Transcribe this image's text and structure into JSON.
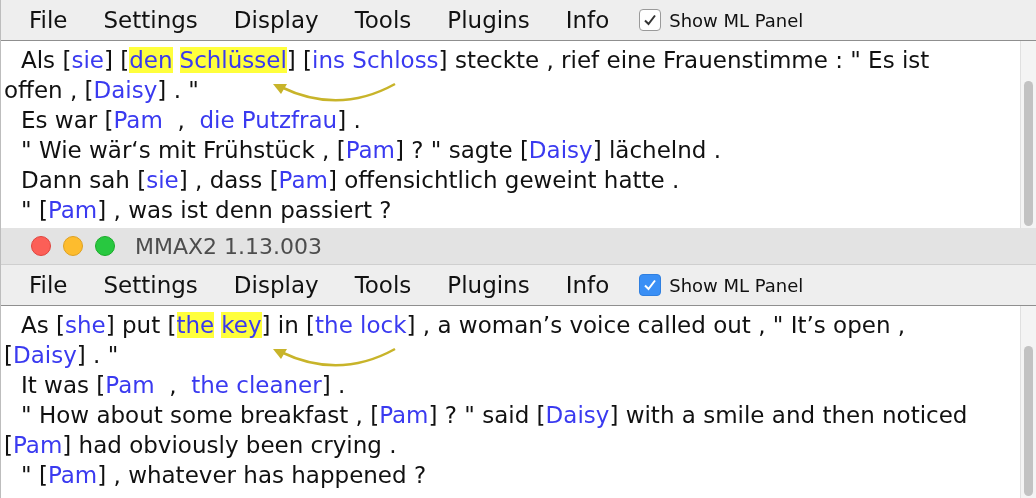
{
  "windows": [
    {
      "focused": false,
      "menu": [
        "File",
        "Settings",
        "Display",
        "Tools",
        "Plugins",
        "Info"
      ],
      "ml_panel": {
        "label": "Show ML Panel",
        "checked": true
      },
      "lines": [
        {
          "kind": "line",
          "segments": [
            {
              "kind": "text",
              "t": "Als ["
            },
            {
              "kind": "mark",
              "t": "sie"
            },
            {
              "kind": "text",
              "t": "] ["
            },
            {
              "kind": "hl",
              "t": "den"
            },
            {
              "kind": "gap"
            },
            {
              "kind": "hl",
              "t": "Schlüssel"
            },
            {
              "kind": "text",
              "t": "] ["
            },
            {
              "kind": "mark",
              "t": "ins Schloss"
            },
            {
              "kind": "text",
              "t": "] steckte , rief eine Frauenstimme : \" Es ist"
            }
          ]
        },
        {
          "kind": "wrap",
          "segments": [
            {
              "kind": "text",
              "t": "offen , ["
            },
            {
              "kind": "mark",
              "t": "Daisy"
            },
            {
              "kind": "text",
              "t": "] . \""
            }
          ]
        },
        {
          "kind": "line",
          "segments": [
            {
              "kind": "text",
              "t": "Es war ["
            },
            {
              "kind": "mark",
              "t": "Pam"
            },
            {
              "kind": "text",
              "t": "  ,  "
            },
            {
              "kind": "mark",
              "t": "die Putzfrau"
            },
            {
              "kind": "text",
              "t": "] ."
            }
          ]
        },
        {
          "kind": "line",
          "segments": [
            {
              "kind": "text",
              "t": "\" Wie wär‘s mit Frühstück , ["
            },
            {
              "kind": "mark",
              "t": "Pam"
            },
            {
              "kind": "text",
              "t": "] ? \" sagte ["
            },
            {
              "kind": "mark",
              "t": "Daisy"
            },
            {
              "kind": "text",
              "t": "] lächelnd ."
            }
          ]
        },
        {
          "kind": "line",
          "segments": [
            {
              "kind": "text",
              "t": "Dann sah ["
            },
            {
              "kind": "mark",
              "t": "sie"
            },
            {
              "kind": "text",
              "t": "] , dass ["
            },
            {
              "kind": "mark",
              "t": "Pam"
            },
            {
              "kind": "text",
              "t": "] offensichtlich geweint hatte ."
            }
          ]
        },
        {
          "kind": "line",
          "segments": [
            {
              "kind": "text",
              "t": "\" ["
            },
            {
              "kind": "mark",
              "t": "Pam"
            },
            {
              "kind": "text",
              "t": "] , was ist denn passiert ?"
            }
          ]
        }
      ]
    },
    {
      "focused": true,
      "title": "MMAX2 1.13.003",
      "menu": [
        "File",
        "Settings",
        "Display",
        "Tools",
        "Plugins",
        "Info"
      ],
      "ml_panel": {
        "label": "Show ML Panel",
        "checked": true
      },
      "lines": [
        {
          "kind": "line",
          "segments": [
            {
              "kind": "text",
              "t": "As ["
            },
            {
              "kind": "mark",
              "t": "she"
            },
            {
              "kind": "text",
              "t": "] put ["
            },
            {
              "kind": "hl",
              "t": "the"
            },
            {
              "kind": "gap"
            },
            {
              "kind": "hl",
              "t": "key"
            },
            {
              "kind": "text",
              "t": "] in ["
            },
            {
              "kind": "mark",
              "t": "the lock"
            },
            {
              "kind": "text",
              "t": "] , a woman’s voice called out , \" It’s open ,"
            }
          ]
        },
        {
          "kind": "wrap",
          "segments": [
            {
              "kind": "text",
              "t": "["
            },
            {
              "kind": "mark",
              "t": "Daisy"
            },
            {
              "kind": "text",
              "t": "] . \""
            }
          ]
        },
        {
          "kind": "line",
          "segments": [
            {
              "kind": "text",
              "t": "It was ["
            },
            {
              "kind": "mark",
              "t": "Pam"
            },
            {
              "kind": "text",
              "t": "  ,  "
            },
            {
              "kind": "mark",
              "t": "the cleaner"
            },
            {
              "kind": "text",
              "t": "] ."
            }
          ]
        },
        {
          "kind": "line",
          "segments": [
            {
              "kind": "text",
              "t": "\" How about some breakfast , ["
            },
            {
              "kind": "mark",
              "t": "Pam"
            },
            {
              "kind": "text",
              "t": "] ? \" said ["
            },
            {
              "kind": "mark",
              "t": "Daisy"
            },
            {
              "kind": "text",
              "t": "] with a smile and then noticed"
            }
          ]
        },
        {
          "kind": "wrap",
          "segments": [
            {
              "kind": "text",
              "t": "["
            },
            {
              "kind": "mark",
              "t": "Pam"
            },
            {
              "kind": "text",
              "t": "] had obviously been crying ."
            }
          ]
        },
        {
          "kind": "line",
          "segments": [
            {
              "kind": "text",
              "t": "\" ["
            },
            {
              "kind": "mark",
              "t": "Pam"
            },
            {
              "kind": "text",
              "t": "] , whatever has happened ?"
            }
          ]
        }
      ]
    }
  ]
}
